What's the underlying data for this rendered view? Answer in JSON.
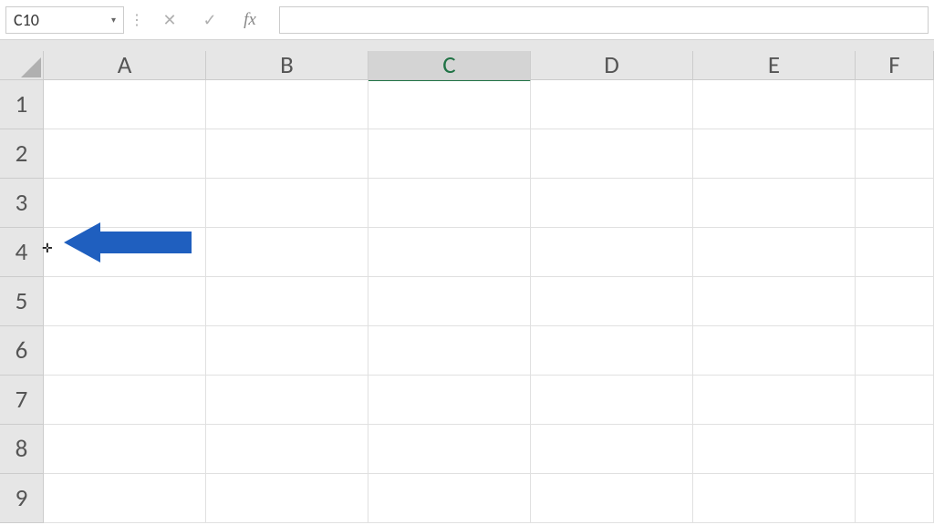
{
  "formula_bar": {
    "name_box_value": "C10",
    "cancel_label": "✕",
    "enter_label": "✓",
    "fx_label": "fx",
    "formula_value": ""
  },
  "columns": [
    "A",
    "B",
    "C",
    "D",
    "E",
    "F"
  ],
  "selected_column": "C",
  "rows": [
    "1",
    "2",
    "3",
    "4",
    "5",
    "6",
    "7",
    "8",
    "9"
  ],
  "annotation": {
    "arrow_color": "#1f5fbf",
    "cursor_glyph": "✛"
  }
}
